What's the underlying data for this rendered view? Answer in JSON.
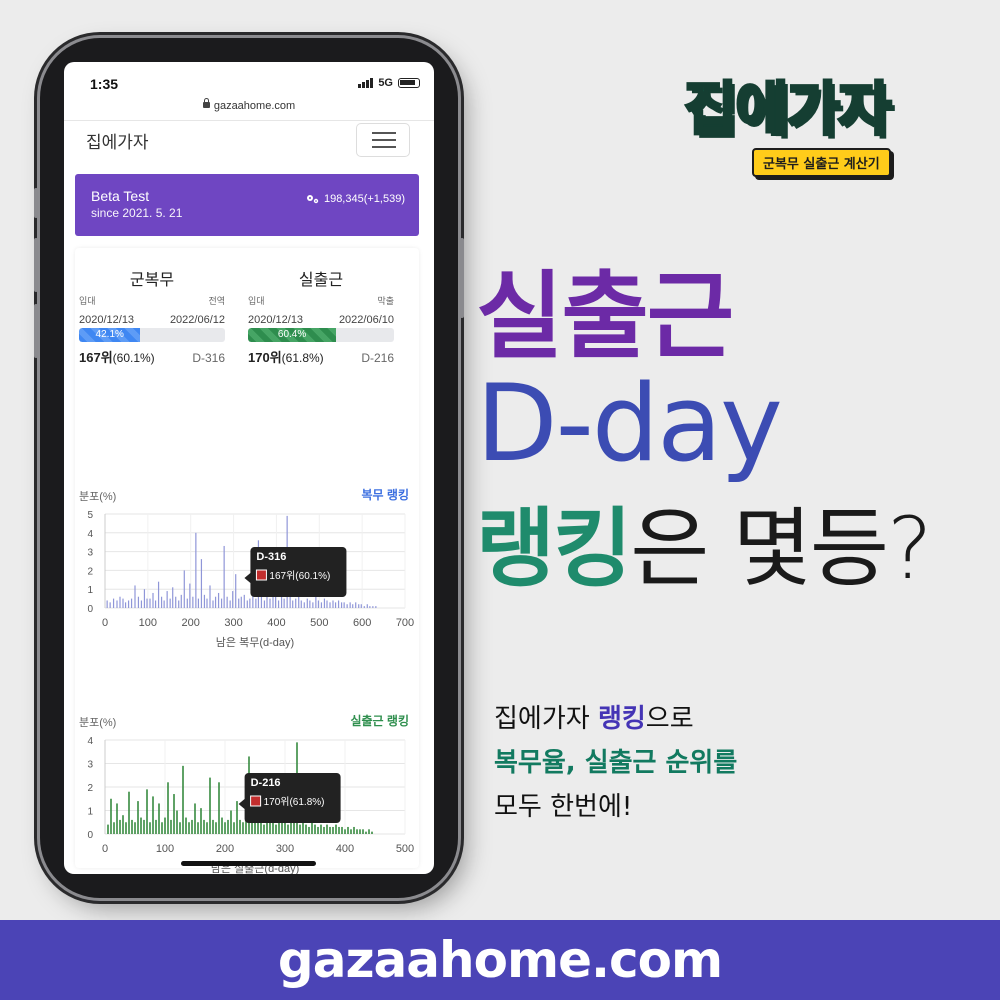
{
  "status_bar": {
    "time": "1:35",
    "network": "5G",
    "url": "gazaahome.com"
  },
  "navbar": {
    "brand": "집에가자"
  },
  "beta": {
    "title": "Beta Test",
    "since": "since 2021. 5. 21",
    "count": "198,345(+1,539)"
  },
  "stats": [
    {
      "title": "군복무",
      "start_label": "입대",
      "end_label": "전역",
      "start_date": "2020/12/13",
      "end_date": "2022/06/12",
      "progress_label": "42.1%",
      "progress": 0.421,
      "rank": "167위",
      "rank_pct": "(60.1%)",
      "dday": "D-316"
    },
    {
      "title": "실출근",
      "start_label": "입대",
      "end_label": "막출",
      "start_date": "2020/12/13",
      "end_date": "2022/06/10",
      "progress_label": "60.4%",
      "progress": 0.604,
      "rank": "170위",
      "rank_pct": "(61.8%)",
      "dday": "D-216"
    }
  ],
  "charts_text": {
    "c1": {
      "left": "분포(%)",
      "right": "복무 랭킹"
    },
    "c2": {
      "left": "분포(%)",
      "right": "실출근 랭킹"
    }
  },
  "chart_data": [
    {
      "type": "bar",
      "ylabel": "분포(%)",
      "xlabel": "남은 복무(d-day)",
      "title": "복무 랭킹",
      "xlim": [
        0,
        700
      ],
      "ylim": [
        0,
        5
      ],
      "xticks": [
        "0",
        "100",
        "200",
        "300",
        "400",
        "500",
        "600",
        "700"
      ],
      "yticks": [
        "0",
        "1",
        "2",
        "3",
        "4",
        "5"
      ],
      "color": "#8f96d8",
      "tooltip": {
        "title": "D-316",
        "body": "167위(60.1%)",
        "x": 316
      },
      "x": [
        5,
        12,
        20,
        28,
        35,
        42,
        48,
        55,
        62,
        70,
        78,
        85,
        92,
        98,
        105,
        112,
        118,
        125,
        132,
        138,
        145,
        152,
        158,
        165,
        172,
        178,
        185,
        192,
        198,
        205,
        212,
        218,
        225,
        232,
        238,
        245,
        252,
        258,
        265,
        272,
        278,
        285,
        292,
        298,
        305,
        312,
        318,
        325,
        332,
        338,
        345,
        352,
        358,
        365,
        372,
        378,
        385,
        392,
        398,
        405,
        412,
        418,
        425,
        432,
        438,
        445,
        452,
        458,
        465,
        472,
        478,
        485,
        492,
        498,
        505,
        512,
        518,
        525,
        532,
        538,
        545,
        552,
        558,
        565,
        572,
        578,
        585,
        592,
        598,
        605,
        612,
        618,
        625,
        632
      ],
      "y": [
        0.4,
        0.3,
        0.5,
        0.4,
        0.6,
        0.5,
        0.3,
        0.4,
        0.5,
        1.2,
        0.6,
        0.4,
        1.0,
        0.5,
        0.5,
        0.8,
        0.4,
        1.4,
        0.6,
        0.4,
        0.9,
        0.5,
        1.1,
        0.6,
        0.4,
        0.7,
        2.0,
        0.5,
        1.3,
        0.6,
        4.0,
        0.5,
        2.6,
        0.7,
        0.5,
        1.2,
        0.4,
        0.6,
        0.8,
        0.5,
        3.3,
        0.6,
        0.4,
        0.9,
        1.8,
        0.5,
        0.6,
        0.7,
        0.4,
        0.5,
        2.3,
        0.5,
        3.6,
        0.6,
        0.4,
        0.8,
        0.5,
        2.0,
        0.6,
        0.4,
        0.7,
        0.5,
        4.9,
        0.6,
        0.4,
        0.5,
        1.0,
        0.4,
        0.3,
        0.5,
        0.4,
        0.3,
        0.6,
        0.4,
        0.3,
        0.5,
        0.4,
        0.3,
        0.4,
        0.3,
        0.4,
        0.3,
        0.3,
        0.2,
        0.3,
        0.2,
        0.3,
        0.2,
        0.2,
        0.1,
        0.2,
        0.1,
        0.1,
        0.1
      ]
    },
    {
      "type": "bar",
      "ylabel": "분포(%)",
      "xlabel": "남은 실출근(d-day)",
      "title": "실출근 랭킹",
      "xlim": [
        0,
        500
      ],
      "ylim": [
        0,
        4
      ],
      "xticks": [
        "0",
        "100",
        "200",
        "300",
        "400",
        "500"
      ],
      "yticks": [
        "0",
        "1",
        "2",
        "3",
        "4"
      ],
      "color": "#3a8c43",
      "tooltip": {
        "title": "D-216",
        "body": "170위(61.8%)",
        "x": 216
      },
      "x": [
        5,
        10,
        15,
        20,
        25,
        30,
        35,
        40,
        45,
        50,
        55,
        60,
        65,
        70,
        75,
        80,
        85,
        90,
        95,
        100,
        105,
        110,
        115,
        120,
        125,
        130,
        135,
        140,
        145,
        150,
        155,
        160,
        165,
        170,
        175,
        180,
        185,
        190,
        195,
        200,
        205,
        210,
        215,
        220,
        225,
        230,
        235,
        240,
        245,
        250,
        255,
        260,
        265,
        270,
        275,
        280,
        285,
        290,
        295,
        300,
        305,
        310,
        315,
        320,
        325,
        330,
        335,
        340,
        345,
        350,
        355,
        360,
        365,
        370,
        375,
        380,
        385,
        390,
        395,
        400,
        405,
        410,
        415,
        420,
        425,
        430,
        435,
        440,
        445
      ],
      "y": [
        0.4,
        1.5,
        0.5,
        1.3,
        0.6,
        0.8,
        0.5,
        1.8,
        0.6,
        0.5,
        1.4,
        0.7,
        0.6,
        1.9,
        0.5,
        1.6,
        0.6,
        1.3,
        0.5,
        0.7,
        2.2,
        0.6,
        1.7,
        1.0,
        0.5,
        2.9,
        0.7,
        0.5,
        0.6,
        1.3,
        0.5,
        1.1,
        0.6,
        0.5,
        2.4,
        0.6,
        0.5,
        2.2,
        0.7,
        0.5,
        0.6,
        1.0,
        0.5,
        1.4,
        0.6,
        0.5,
        0.7,
        3.3,
        0.6,
        2.5,
        0.5,
        0.6,
        0.4,
        0.5,
        0.6,
        0.5,
        0.4,
        1.2,
        0.5,
        0.6,
        0.4,
        0.5,
        0.6,
        3.9,
        0.4,
        0.5,
        0.4,
        0.3,
        0.5,
        0.4,
        0.3,
        0.4,
        0.3,
        0.4,
        0.3,
        0.3,
        0.4,
        0.3,
        0.3,
        0.2,
        0.3,
        0.2,
        0.3,
        0.2,
        0.2,
        0.2,
        0.1,
        0.2,
        0.1
      ]
    }
  ],
  "logo": {
    "text1": "집에",
    "text2": "가자",
    "badge": "군복무 실출근 계산기"
  },
  "headline": {
    "line1": "실출근",
    "line2": "D-day",
    "line3_green": "랭킹",
    "line3_rest": "은 몇등?"
  },
  "description": {
    "l1_a": "집에가자 ",
    "l1_b": "랭킹",
    "l1_c": "으로",
    "l2": "복무율, 실출근 순위를",
    "l3": "모두 한번에!"
  },
  "footer": {
    "domain": "gazaahome.com"
  },
  "colors": {
    "purple": "#6c2aa6",
    "blue": "#3c4cb3",
    "green": "#1f8b6c",
    "banner": "#4b44b6",
    "beta": "#6f46c2"
  }
}
